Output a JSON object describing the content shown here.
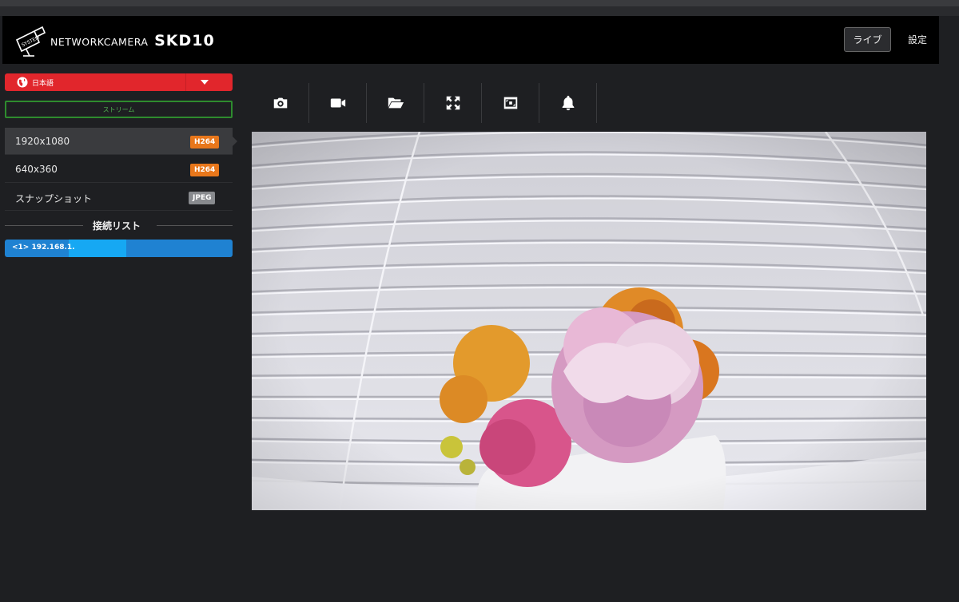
{
  "app": {
    "brand_small": "NETWORKCAMERA",
    "brand_big": "SKD10",
    "logo_icon": "camera-logo-icon"
  },
  "nav": {
    "live_label": "ライブ",
    "settings_label": "設定"
  },
  "sidebar": {
    "language": {
      "label": "日本語",
      "icon": "globe-icon"
    },
    "stream_label": "ストリーム",
    "resolutions": [
      {
        "label": "1920x1080",
        "codec": "H264"
      },
      {
        "label": "640x360",
        "codec": "H264"
      },
      {
        "label": "スナップショット",
        "codec": "JPEG"
      }
    ],
    "connection_title": "接続リスト",
    "connections": [
      {
        "label": "<1> 192.168.1."
      }
    ]
  },
  "toolbar": {
    "icons": [
      "camera-icon",
      "video-record-icon",
      "folder-open-icon",
      "fullscreen-icon",
      "fit-screen-icon",
      "bell-icon"
    ]
  },
  "colors": {
    "accent_red": "#e1262c",
    "stream_green": "#2e8b2e",
    "codec_orange": "#e8771b",
    "connection_blue": "#1f82d2"
  }
}
